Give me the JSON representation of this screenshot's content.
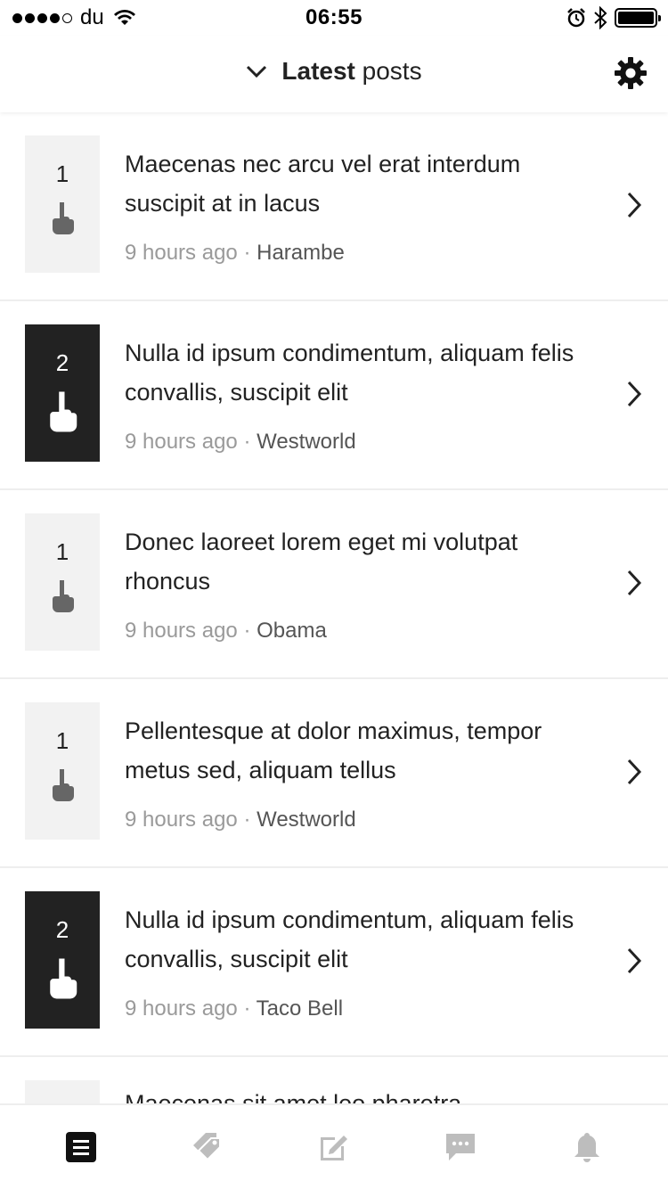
{
  "status_bar": {
    "carrier": "du",
    "time": "06:55"
  },
  "header": {
    "title_bold": "Latest",
    "title_rest": "posts"
  },
  "posts": [
    {
      "votes": "1",
      "voted": false,
      "title": "Maecenas nec arcu vel erat interdum suscipit at in lacus",
      "time": "9 hours ago",
      "sep": "·",
      "author": "Harambe"
    },
    {
      "votes": "2",
      "voted": true,
      "title": "Nulla id ipsum condimentum, aliquam felis convallis, suscipit elit",
      "time": "9 hours ago",
      "sep": "·",
      "author": "Westworld"
    },
    {
      "votes": "1",
      "voted": false,
      "title": "Donec laoreet lorem eget mi volutpat rhoncus",
      "time": "9 hours ago",
      "sep": "·",
      "author": "Obama"
    },
    {
      "votes": "1",
      "voted": false,
      "title": "Pellentesque at dolor maximus, tempor metus sed, aliquam tellus",
      "time": "9 hours ago",
      "sep": "·",
      "author": "Westworld"
    },
    {
      "votes": "2",
      "voted": true,
      "title": "Nulla id ipsum condimentum, aliquam felis convallis, suscipit elit",
      "time": "9 hours ago",
      "sep": "·",
      "author": "Taco Bell"
    },
    {
      "votes": "",
      "voted": false,
      "title": "Maecenas sit amet leo pharetra",
      "time": "",
      "sep": "",
      "author": ""
    }
  ],
  "icons": {
    "header_toggle": "chevron-down-icon",
    "settings": "gear-icon",
    "row_action": "chevron-right-icon",
    "vote": "pointing-hand-icon",
    "tabs": [
      "list-icon",
      "tags-icon",
      "compose-icon",
      "chat-icon",
      "bell-icon"
    ]
  },
  "colors": {
    "active": "#222222",
    "inactive_tab": "#bdbdbd",
    "vote_bg": "#f2f2f2",
    "meta": "#9a9a9a"
  }
}
